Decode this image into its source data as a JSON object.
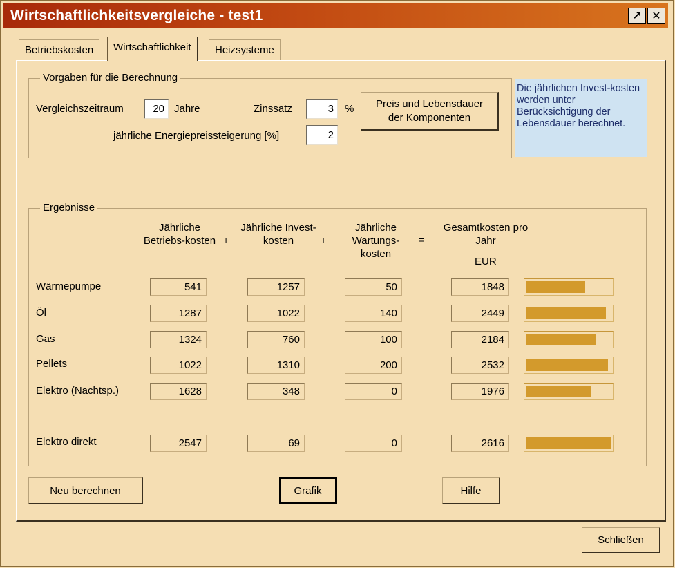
{
  "window": {
    "title": "Wirtschaftlichkeitsvergleiche - test1"
  },
  "tabs": [
    {
      "label": "Betriebskosten",
      "active": false
    },
    {
      "label": "Wirtschaftlichkeit",
      "active": true
    },
    {
      "label": "Heizsysteme",
      "active": false
    }
  ],
  "vorgaben": {
    "legend": "Vorgaben für die Berechnung",
    "vergleichszeitraum_label": "Vergleichszeitraum",
    "vergleichszeitraum_value": "20",
    "jahre_label": "Jahre",
    "zinssatz_label": "Zinssatz",
    "zinssatz_value": "3",
    "percent_label": "%",
    "energie_label": "jährliche Energiepreissteigerung [%]",
    "energie_value": "2",
    "preis_button": "Preis und Lebensdauer der Komponenten"
  },
  "info_text": "Die jährlichen Invest-kosten werden unter Berücksichtigung der Lebensdauer berechnet.",
  "ergebnisse": {
    "legend": "Ergebnisse",
    "headers": {
      "betrieb": "Jährliche Betriebs-kosten",
      "invest": "Jährliche Invest-kosten",
      "wartung": "Jährliche Wartungs-kosten",
      "gesamt": "Gesamtkosten pro Jahr",
      "unit": "EUR",
      "plus": "+",
      "equals": "="
    },
    "rows": [
      {
        "name": "Wärmepumpe",
        "betrieb": "541",
        "invest": "1257",
        "wartung": "50",
        "gesamt": "1848",
        "bar": 0.7
      },
      {
        "name": "Öl",
        "betrieb": "1287",
        "invest": "1022",
        "wartung": "140",
        "gesamt": "2449",
        "bar": 0.94
      },
      {
        "name": "Gas",
        "betrieb": "1324",
        "invest": "760",
        "wartung": "100",
        "gesamt": "2184",
        "bar": 0.83
      },
      {
        "name": "Pellets",
        "betrieb": "1022",
        "invest": "1310",
        "wartung": "200",
        "gesamt": "2532",
        "bar": 0.97
      },
      {
        "name": "Elektro (Nachtsp.)",
        "betrieb": "1628",
        "invest": "348",
        "wartung": "0",
        "gesamt": "1976",
        "bar": 0.76
      },
      {
        "name": "Elektro direkt",
        "betrieb": "2547",
        "invest": "69",
        "wartung": "0",
        "gesamt": "2616",
        "bar": 1.0
      }
    ]
  },
  "buttons": {
    "neu_berechnen": "Neu berechnen",
    "grafik": "Grafik",
    "hilfe": "Hilfe",
    "schliessen": "Schließen"
  },
  "icons": [
    "restore-icon",
    "close-icon"
  ]
}
